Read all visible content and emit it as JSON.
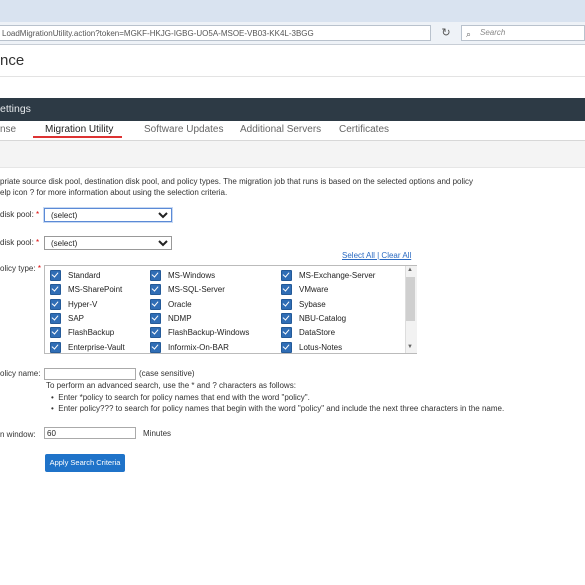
{
  "browser": {
    "url": "LoadMigrationUtility.action?token=MGKF-HKJG-IGBG-UO5A-MSOE-VB03-KK4L-3BGG",
    "search_placeholder": "Search"
  },
  "app": {
    "title": "nce",
    "section_bar": "ettings"
  },
  "tabs": [
    {
      "label": "nse"
    },
    {
      "label": "Migration Utility"
    },
    {
      "label": "Software Updates"
    },
    {
      "label": "Additional Servers"
    },
    {
      "label": "Certificates"
    }
  ],
  "intro": {
    "line1": "priate source disk pool, destination disk pool, and policy types. The migration job that runs is based on the selected options and policy",
    "line2": "elp icon  ?  for more information about using the selection criteria."
  },
  "form": {
    "source_label": "disk pool:",
    "source_value": "(select)",
    "dest_label": "disk pool:",
    "dest_value": "(select)",
    "policy_type_label": "olicy type:",
    "required_mark": "*",
    "select_all": "Select All | Clear All",
    "policy_types": [
      [
        "Standard",
        "MS-Windows",
        "MS-Exchange-Server"
      ],
      [
        "MS-SharePoint",
        "MS-SQL-Server",
        "VMware"
      ],
      [
        "Hyper-V",
        "Oracle",
        "Sybase"
      ],
      [
        "SAP",
        "NDMP",
        "NBU-Catalog"
      ],
      [
        "FlashBackup",
        "FlashBackup-Windows",
        "DataStore"
      ],
      [
        "Enterprise-Vault",
        "Informix-On-BAR",
        "Lotus-Notes"
      ]
    ],
    "policy_name_label": "olicy name:",
    "policy_name_value": "",
    "case_note": "(case sensitive)",
    "adv_intro": "To perform an advanced search, use the * and ? characters as follows:",
    "adv_bullet1": "Enter *policy to search for policy names that end with the word \"policy\".",
    "adv_bullet2": "Enter policy??? to search for policy names that begin with the word \"policy\" and include the next three characters in the name.",
    "window_label": "n window:",
    "window_value": "60",
    "window_unit": "Minutes",
    "apply_label": "Apply Search Criteria"
  }
}
